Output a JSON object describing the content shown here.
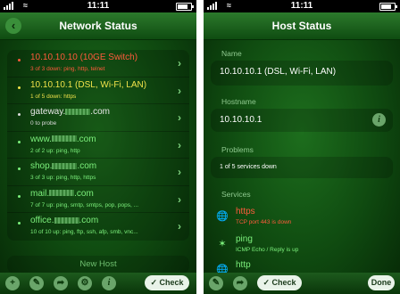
{
  "status_bar": {
    "time": "11:11"
  },
  "left_screen": {
    "title": "Network Status",
    "hosts": [
      {
        "name": "10.10.10.10 (10GE Switch)",
        "status": "3 of 3 down: ping, http, telnet",
        "name_color": "#ff5a3c",
        "status_color": "#ff5a3c",
        "dot_color": "#ff5a3c"
      },
      {
        "name": "10.10.10.1 (DSL, Wi-Fi, LAN)",
        "status": "1 of 5 down: https",
        "name_color": "#f0e24a",
        "status_color": "#f0e24a",
        "dot_color": "#f0e24a"
      },
      {
        "name_prefix": "gateway.",
        "name_suffix": ".com",
        "status": "0 to probe",
        "name_color": "#e8e8e8",
        "status_color": "#dcdcdc",
        "dot_color": "#dcdcdc"
      },
      {
        "name_prefix": "www.",
        "name_suffix": ".com",
        "status": "2 of 2 up: ping, http",
        "name_color": "#7cf07c",
        "status_color": "#7cf07c",
        "dot_color": "#7cf07c"
      },
      {
        "name_prefix": "shop.",
        "name_suffix": ".com",
        "status": "3 of 3 up: ping, http, https",
        "name_color": "#7cf07c",
        "status_color": "#7cf07c",
        "dot_color": "#7cf07c"
      },
      {
        "name_prefix": "mail.",
        "name_suffix": ".com",
        "status": "7 of 7 up: ping, smtp, smtps, pop, pops, ...",
        "name_color": "#7cf07c",
        "status_color": "#7cf07c",
        "dot_color": "#7cf07c"
      },
      {
        "name_prefix": "office.",
        "name_suffix": ".com",
        "status": "10 of 10 up: ping, ftp, ssh, afp, smb, vnc...",
        "name_color": "#7cf07c",
        "status_color": "#7cf07c",
        "dot_color": "#7cf07c"
      }
    ],
    "new_host_label": "New Host",
    "check_label": "Check",
    "toolbar_icons": [
      "add-icon",
      "edit-icon",
      "forward-icon",
      "tool-icon",
      "info-icon"
    ]
  },
  "right_screen": {
    "title": "Host Status",
    "name_label": "Name",
    "name_value": "10.10.10.1 (DSL, Wi-Fi, LAN)",
    "hostname_label": "Hostname",
    "hostname_value": "10.10.10.1",
    "problems_label": "Problems",
    "problems_value": "1 of 5 services down",
    "services_label": "Services",
    "services": [
      {
        "name": "https",
        "detail": "TCP port 443 is down",
        "color": "#ff5a3c",
        "icon": "globe-icon"
      },
      {
        "name": "ping",
        "detail": "ICMP Echo / Reply is up",
        "color": "#7cf07c",
        "icon": "ping-icon"
      },
      {
        "name": "http",
        "detail": "",
        "color": "#7cf07c",
        "icon": "globe-icon"
      }
    ],
    "check_label": "Check",
    "done_label": "Done"
  }
}
